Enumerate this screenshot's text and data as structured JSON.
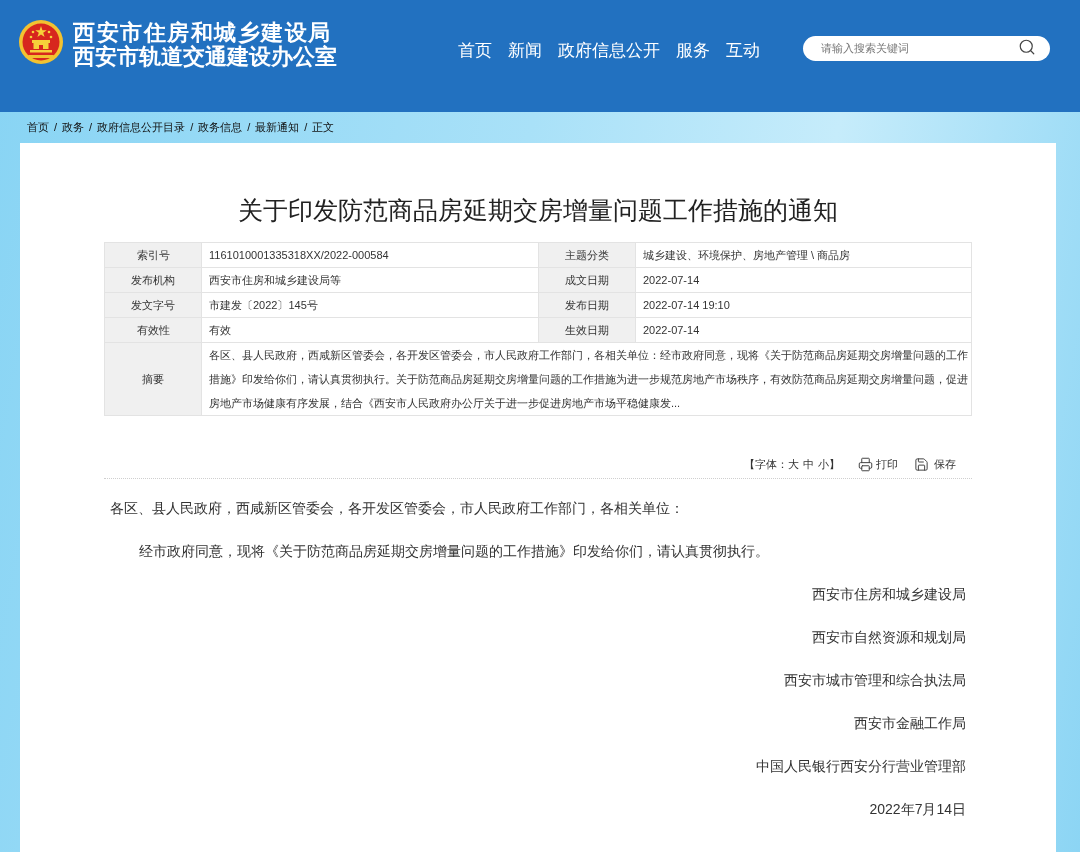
{
  "header": {
    "title_lines": [
      "西安市住房和城乡建设局",
      "西安市轨道交通建设办公室"
    ],
    "nav": [
      {
        "label": "首页"
      },
      {
        "label": "新闻"
      },
      {
        "label": "政府信息公开"
      },
      {
        "label": "服务"
      },
      {
        "label": "互动"
      }
    ],
    "search": {
      "placeholder": "请输入搜索关键词"
    }
  },
  "breadcrumb": {
    "items": [
      "首页",
      "政务",
      "政府信息公开目录",
      "政务信息",
      "最新通知",
      "正文"
    ],
    "separator": "/"
  },
  "article": {
    "title": "关于印发防范商品房延期交房增量问题工作措施的通知",
    "info_table": {
      "rows": [
        [
          {
            "label": "索引号",
            "value": "1161010001335318XX/2022-000584"
          },
          {
            "label": "主题分类",
            "value": "城乡建设、环境保护、房地产管理 \\ 商品房"
          }
        ],
        [
          {
            "label": "发布机构",
            "value": "西安市住房和城乡建设局等"
          },
          {
            "label": "成文日期",
            "value": "2022-07-14"
          }
        ],
        [
          {
            "label": "发文字号",
            "value": "市建发〔2022〕145号"
          },
          {
            "label": "发布日期",
            "value": "2022-07-14 19:10"
          }
        ],
        [
          {
            "label": "有效性",
            "value": "有效"
          },
          {
            "label": "生效日期",
            "value": "2022-07-14"
          }
        ]
      ],
      "summary": {
        "label": "摘要",
        "value": "各区、县人民政府，西咸新区管委会，各开发区管委会，市人民政府工作部门，各相关单位：经市政府同意，现将《关于防范商品房延期交房增量问题的工作措施》印发给你们，请认真贯彻执行。关于防范商品房延期交房增量问题的工作措施为进一步规范房地产市场秩序，有效防范商品房延期交房增量问题，促进房地产市场健康有序发展，结合《西安市人民政府办公厅关于进一步促进房地产市场平稳健康发..."
      }
    },
    "tools": {
      "font_label": "【字体：",
      "font_sizes": [
        "大",
        "中",
        "小"
      ],
      "font_label_end": "】",
      "print": "打印",
      "save": "保存"
    },
    "salutation": "各区、县人民政府，西咸新区管委会，各开发区管委会，市人民政府工作部门，各相关单位：",
    "paragraphs": [
      "经市政府同意，现将《关于防范商品房延期交房增量问题的工作措施》印发给你们，请认真贯彻执行。"
    ],
    "signatures": [
      "西安市住房和城乡建设局",
      "西安市自然资源和规划局",
      "西安市城市管理和综合执法局",
      "西安市金融工作局",
      "中国人民银行西安分行营业管理部"
    ],
    "date": "2022年7月14日"
  }
}
